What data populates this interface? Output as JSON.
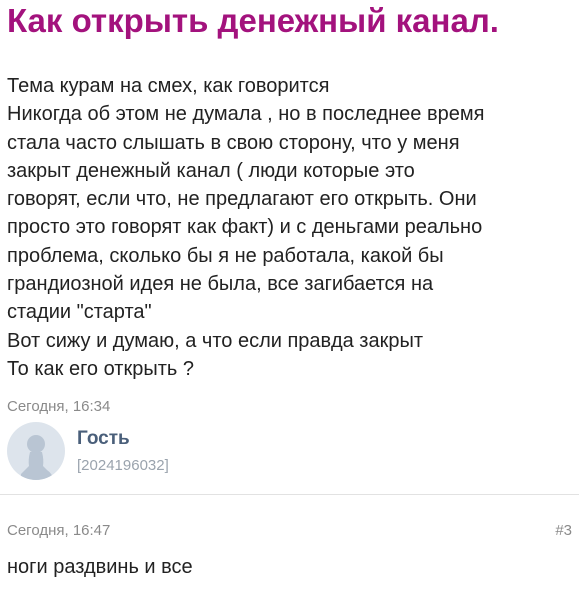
{
  "title": "Как открыть денежный канал.",
  "post": {
    "lines": [
      "Тема курам на смех, как говорится",
      "Никогда об этом не думала , но в последнее время",
      "стала часто слышать в свою сторону, что у меня",
      "закрыт денежный канал ( люди которые это",
      "говорят, если что, не предлагают его открыть. Они",
      "просто это говорят как факт) и с деньгами реально",
      "проблема, сколько бы я не работала, какой бы",
      "грандиозной идея не была, все загибается на",
      "стадии \"старта\"",
      "Вот сижу и думаю, а что если правда закрыт",
      "То как его открыть ?"
    ],
    "timestamp": "Сегодня, 16:34"
  },
  "author": {
    "name": "Гость",
    "id": "[2024196032]",
    "avatar_icon": "user-silhouette-icon"
  },
  "reply": {
    "timestamp": "Сегодня, 16:47",
    "number": "#3",
    "text": "ноги раздвинь и все"
  },
  "colors": {
    "title": "#a3127d",
    "author_name": "#4a5f7a",
    "meta": "#8a8a8a",
    "avatar_bg": "#dde4ec",
    "avatar_figure": "#b9c5d3"
  }
}
